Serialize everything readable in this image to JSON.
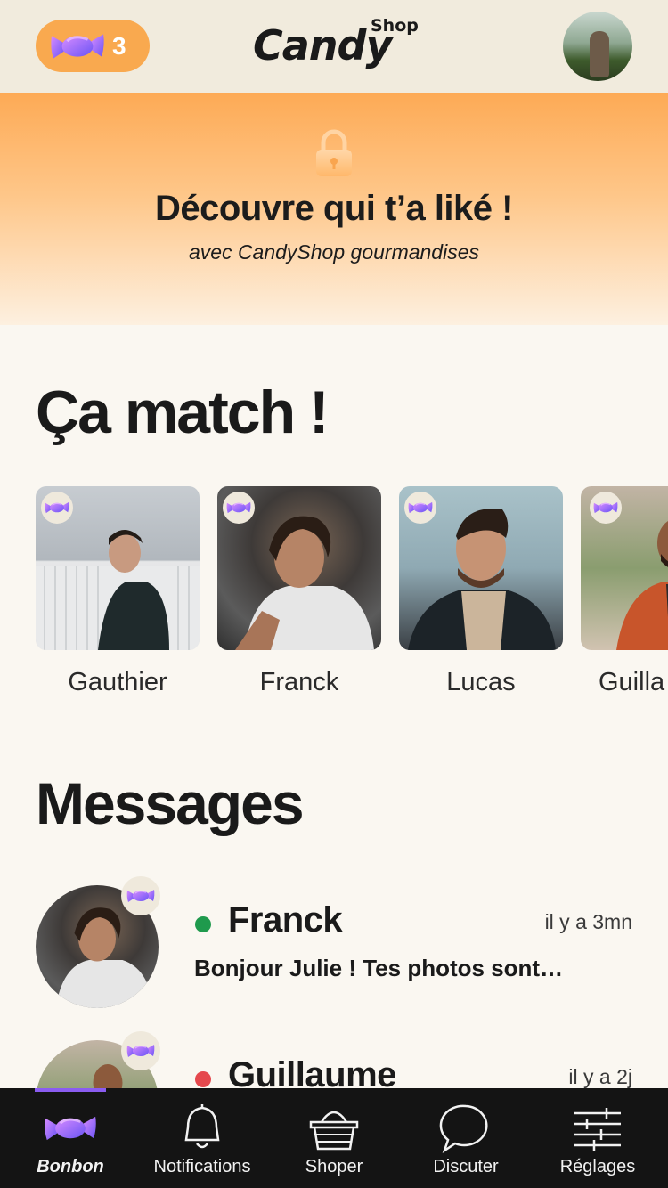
{
  "header": {
    "candy_count": "3",
    "logo_main": "Candy",
    "logo_sub": "Shop"
  },
  "banner": {
    "title": "Découvre qui t’a liké !",
    "subtitle": "avec CandyShop gourmandises"
  },
  "matches": {
    "title": "Ça match !",
    "items": [
      {
        "name": "Gauthier"
      },
      {
        "name": "Franck"
      },
      {
        "name": "Lucas"
      },
      {
        "name": "Guilla"
      }
    ]
  },
  "messages": {
    "title": "Messages",
    "items": [
      {
        "name": "Franck",
        "time": "il y a 3mn",
        "preview": "Bonjour Julie ! Tes photos sont…",
        "status_color": "#1f9a4d"
      },
      {
        "name": "Guillaume",
        "time": "il y a 2j",
        "preview": "",
        "status_color": "#e5484d"
      }
    ]
  },
  "nav": {
    "items": [
      {
        "label": "Bonbon",
        "icon": "candy-icon",
        "active": true
      },
      {
        "label": "Notifications",
        "icon": "bell-icon",
        "active": false
      },
      {
        "label": "Shoper",
        "icon": "basket-icon",
        "active": false
      },
      {
        "label": "Discuter",
        "icon": "chat-bubble-icon",
        "active": false
      },
      {
        "label": "Réglages",
        "icon": "sliders-icon",
        "active": false
      }
    ]
  },
  "colors": {
    "accent_orange": "#f9a94f",
    "nav_indicator": "#8a5cf0",
    "online": "#1f9a4d",
    "away": "#e5484d"
  }
}
